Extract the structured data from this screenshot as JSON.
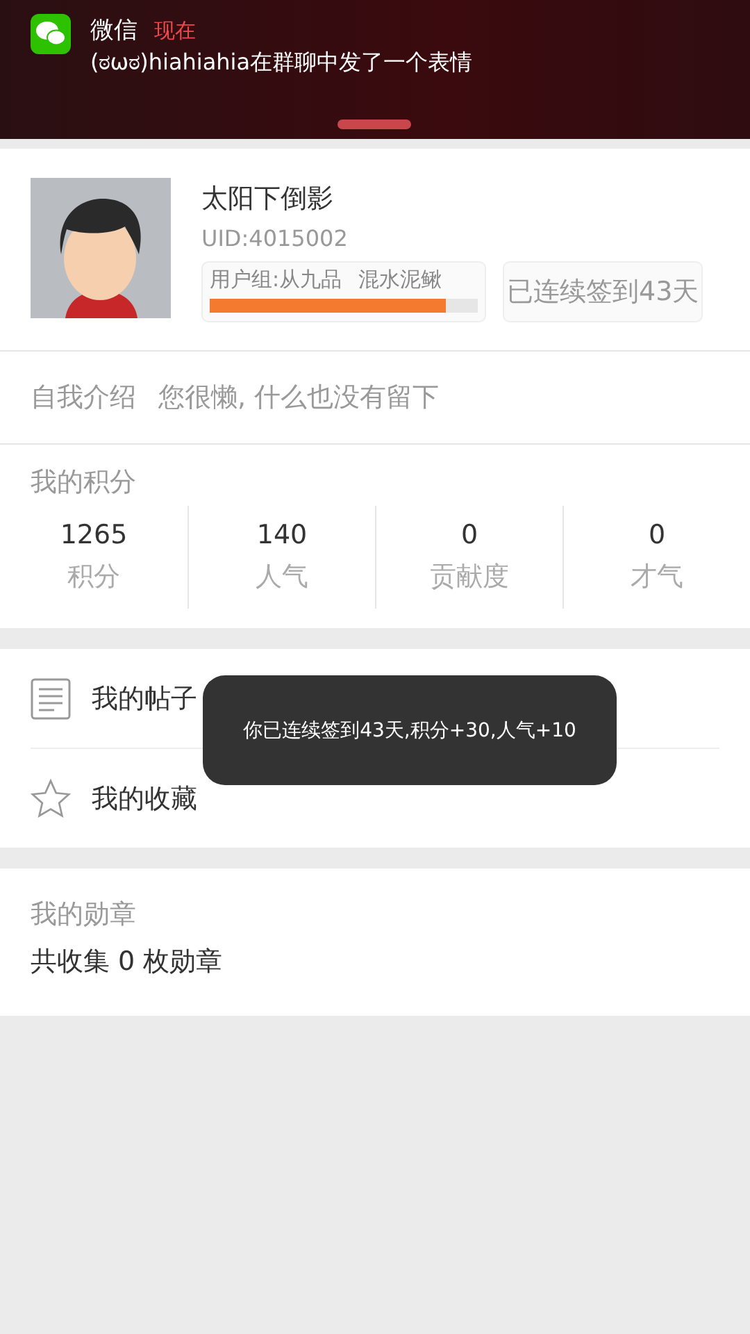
{
  "notification": {
    "app": "微信",
    "time": "现在",
    "message": "(ಠωಠ)hiahiahia在群聊中发了一个表情"
  },
  "profile": {
    "name": "太阳下倒影",
    "uid": "UID:4015002",
    "group": "用户组:从九品",
    "rank": "混水泥鳅",
    "level": 0.88,
    "checkin": "已连续签到43天"
  },
  "intro": {
    "label": "自我介绍",
    "text": "您很懒, 什么也没有留下"
  },
  "points": {
    "title": "我的积分",
    "stats": [
      {
        "value": "1265",
        "label": "积分"
      },
      {
        "value": "140",
        "label": "人气"
      },
      {
        "value": "0",
        "label": "贡献度"
      },
      {
        "value": "0",
        "label": "才气"
      }
    ]
  },
  "menu": [
    {
      "kind": "posts",
      "label": "我的帖子"
    },
    {
      "kind": "favorites",
      "label": "我的收藏"
    }
  ],
  "medals": {
    "title": "我的勋章",
    "summary": "共收集 0 枚勋章"
  },
  "toast": "你已连续签到43天,积分+30,人气+10"
}
